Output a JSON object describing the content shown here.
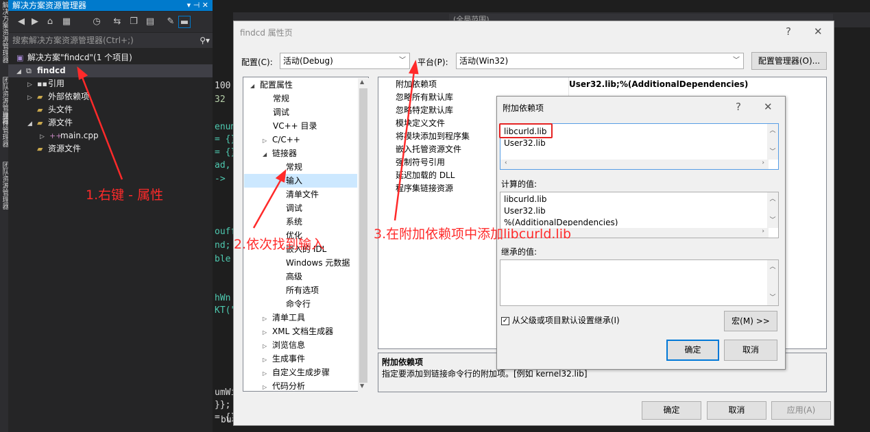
{
  "side_tabs": [
    "解决方案资源管理器",
    "团队资源管理器",
    "属性管理器",
    "团队资源管理器"
  ],
  "solution_explorer": {
    "title": "解决方案资源管理器",
    "title_buttons": "▾ ⊣ ✕",
    "search_placeholder": "搜索解决方案资源管理器(Ctrl+;)",
    "tree": [
      {
        "label": "解决方案\"findcd\"(1 个项目)"
      },
      {
        "label": "findcd"
      },
      {
        "label": "引用"
      },
      {
        "label": "外部依赖项"
      },
      {
        "label": "头文件"
      },
      {
        "label": "源文件"
      },
      {
        "label": "main.cpp"
      },
      {
        "label": "资源文件"
      }
    ]
  },
  "code_fragments": [
    "100",
    "32",
    "enume",
    "= {}",
    "= {}",
    "ad, i",
    "->",
    "ouff",
    "nd;",
    "ble",
    "hWn",
    "KT(\"",
    "umWi",
    "}};",
    "= {}",
    "buffer, 256);"
  ],
  "scope": {
    "text": "(全局范围)"
  },
  "properties_dialog": {
    "title": "findcd 属性页",
    "help": "?",
    "close": "✕",
    "config_label": "配置(C):",
    "config_value": "活动(Debug)",
    "platform_label": "平台(P):",
    "platform_value": "活动(Win32)",
    "config_manager": "配置管理器(O)...",
    "tree": [
      "配置属性",
      "常规",
      "调试",
      "VC++ 目录",
      "C/C++",
      "链接器",
      "常规",
      "输入",
      "清单文件",
      "调试",
      "系统",
      "优化",
      "嵌入的 IDL",
      "Windows 元数据",
      "高级",
      "所有选项",
      "命令行",
      "清单工具",
      "XML 文档生成器",
      "浏览信息",
      "生成事件",
      "自定义生成步骤",
      "代码分析"
    ],
    "grid_rows": [
      "附加依赖项",
      "忽略所有默认库",
      "忽略特定默认库",
      "模块定义文件",
      "将模块添加到程序集",
      "嵌入托管资源文件",
      "强制符号引用",
      "延迟加载的 DLL",
      "程序集链接资源"
    ],
    "grid_value": "User32.lib;%(AdditionalDependencies)",
    "desc_title": "附加依赖项",
    "desc_text": "指定要添加到链接命令行的附加项。[例如 kernel32.lib]",
    "ok": "确定",
    "cancel": "取消",
    "apply": "应用(A)"
  },
  "dependency_dialog": {
    "title": "附加依赖项",
    "help": "?",
    "close": "✕",
    "entries": [
      "libcurld.lib",
      "User32.lib"
    ],
    "computed_label": "计算的值:",
    "computed": [
      "libcurld.lib",
      "User32.lib",
      "%(AdditionalDependencies)"
    ],
    "inherited_label": "继承的值:",
    "inherit_checkbox": "从父级或项目默认设置继承(I)",
    "macro": "宏(M) >>",
    "ok": "确定",
    "cancel": "取消"
  },
  "annotations": {
    "step1": "1.右键 - 属性",
    "step2": "2.依次找到输入",
    "step3": "3.在附加依赖项中添加libcurld.lib"
  },
  "colors": {
    "accent": "#007acc",
    "annotation": "#ff2a2a",
    "selection": "#cce8ff"
  }
}
